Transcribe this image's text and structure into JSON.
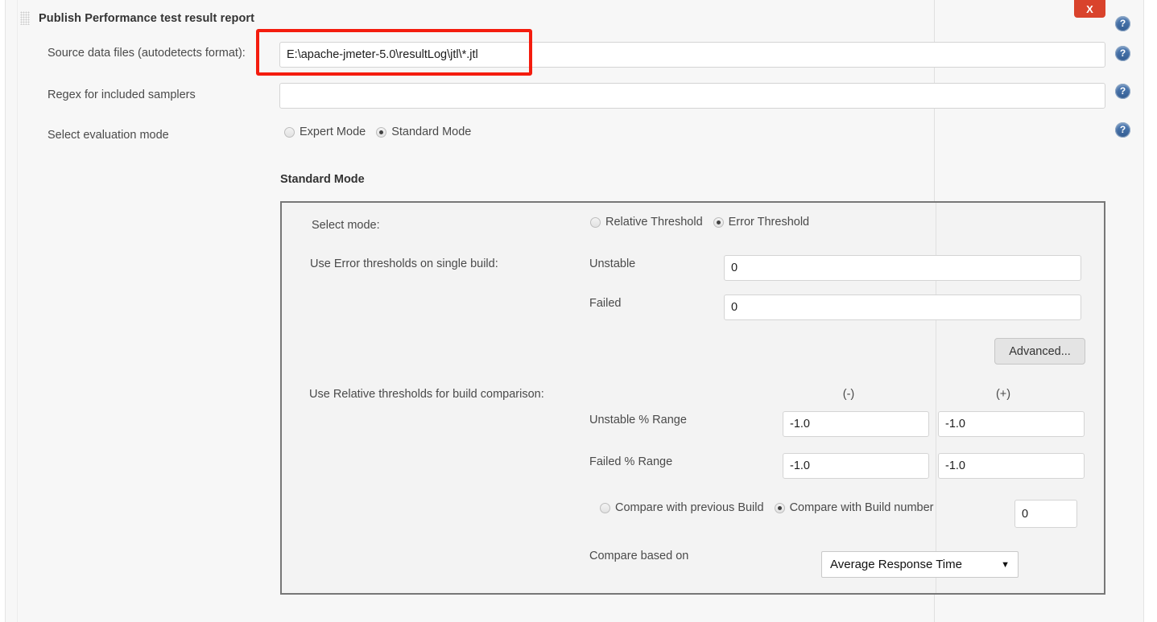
{
  "window": {
    "title": "Publish Performance test result report",
    "close_label": "X",
    "drag_handle": "drag-handle"
  },
  "form": {
    "source_data_files": {
      "label": "Source data files (autodetects format):",
      "value": "E:\\apache-jmeter-5.0\\resultLog\\jtl\\*.jtl",
      "placeholder": ""
    },
    "regex_samplers": {
      "label": "Regex for included samplers",
      "value": "",
      "placeholder": ""
    },
    "evaluation_mode": {
      "label": "Select evaluation mode",
      "options": [
        {
          "label": "Expert Mode",
          "checked": false
        },
        {
          "label": "Standard Mode",
          "checked": true
        }
      ]
    }
  },
  "standard_mode": {
    "title": "Standard Mode",
    "select_mode": {
      "label": "Select mode:",
      "options": [
        {
          "label": "Relative Threshold",
          "checked": false
        },
        {
          "label": "Error Threshold",
          "checked": true
        }
      ]
    },
    "error_thresholds": {
      "label": "Use Error thresholds on single build:",
      "unstable_label": "Unstable",
      "unstable_value": "0",
      "failed_label": "Failed",
      "failed_value": "0"
    },
    "advanced_button": "Advanced...",
    "relative_thresholds": {
      "label": "Use Relative thresholds for build comparison:",
      "col_minus": "(-)",
      "col_plus": "(+)",
      "unstable_label": "Unstable % Range",
      "unstable_minus": "-1.0",
      "unstable_plus": "-1.0",
      "failed_label": "Failed % Range",
      "failed_minus": "-1.0",
      "failed_plus": "-1.0"
    },
    "compare_build": {
      "options": [
        {
          "label": "Compare with previous Build",
          "checked": false
        },
        {
          "label": "Compare with Build number",
          "checked": true
        }
      ],
      "build_number_value": "0"
    },
    "compare_based_on": {
      "label": "Compare based on",
      "selected": "Average Response Time",
      "arrow": "▼"
    }
  },
  "help_icons": {
    "glyph": "?",
    "count": 4
  },
  "colors": {
    "close_button": "#d9432c",
    "help_icon": "#4d74a8",
    "annotation": "#f41c0e",
    "panel_border": "#777777",
    "page_background": "#f7f7f7"
  }
}
